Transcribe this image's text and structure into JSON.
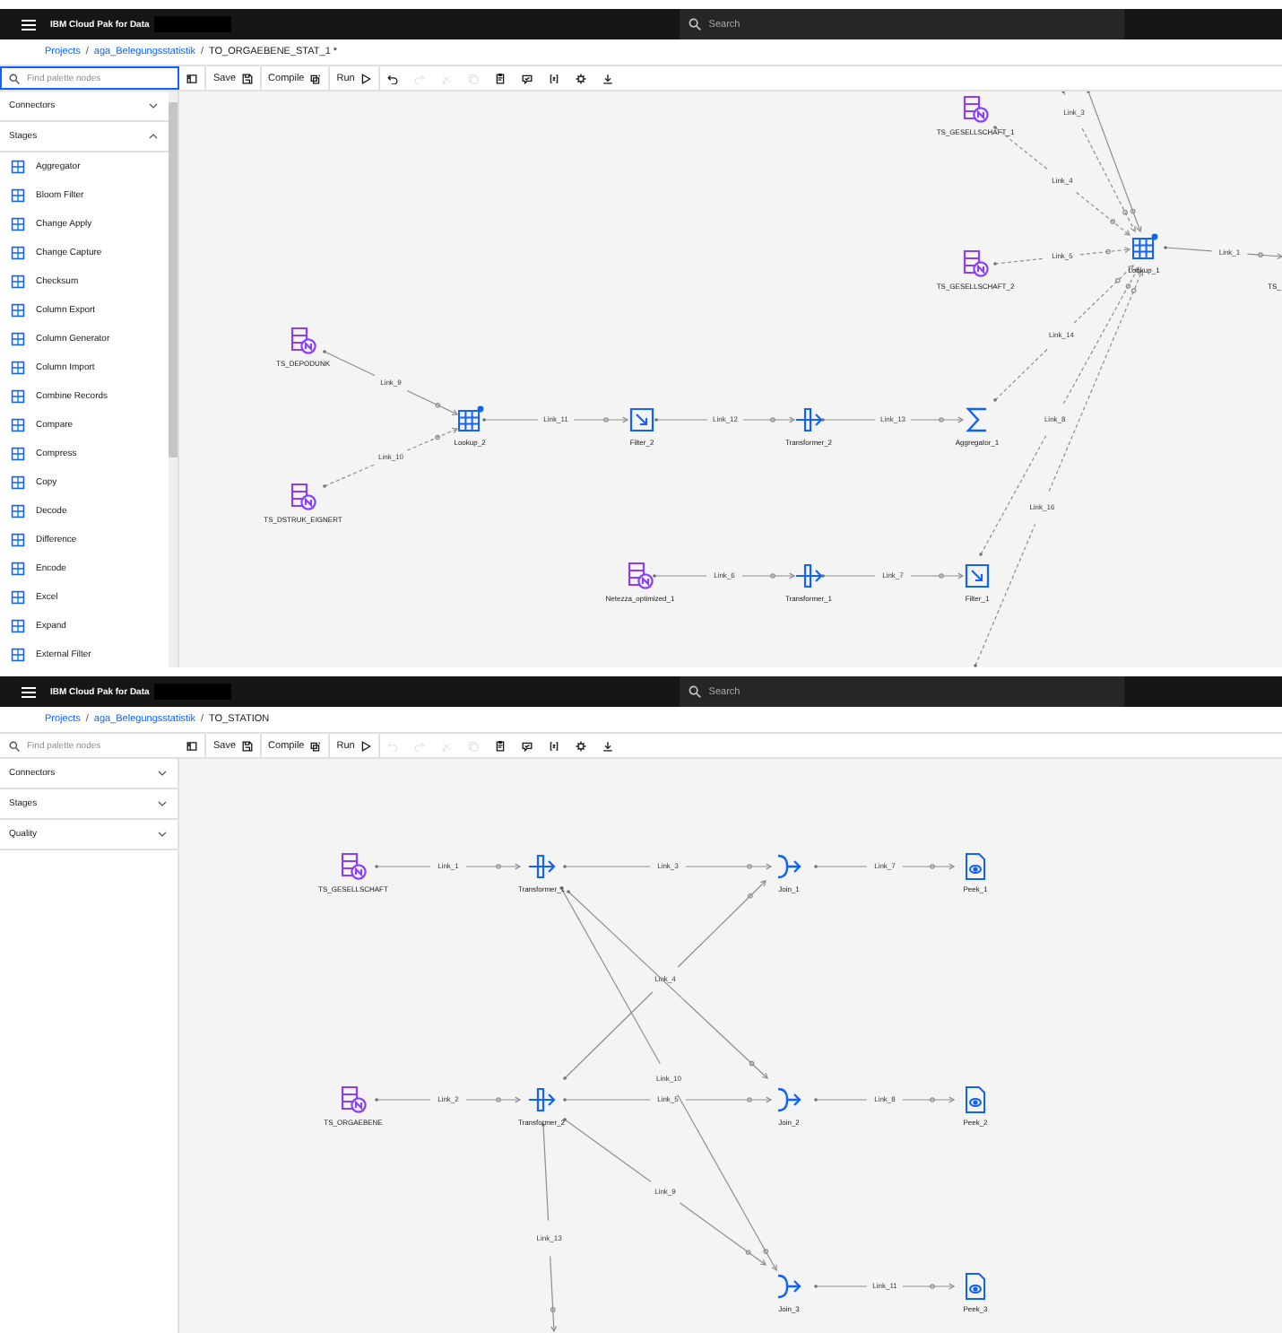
{
  "screens": [
    {
      "header": {
        "title": "IBM Cloud Pak for Data",
        "search": {
          "placeholder": "Search"
        }
      },
      "breadcrumb": [
        {
          "label": "Projects",
          "link": true,
          "separator": "/"
        },
        {
          "label": "aga_Belegungsstatistik",
          "link": true,
          "separator": "/"
        },
        {
          "label": "TO_ORGAEBENE_STAT_1 *",
          "link": false
        }
      ],
      "palette_search": {
        "placeholder": "Find palette nodes",
        "focused": true
      },
      "toolbar": [
        {
          "kind": "palette",
          "disabled": false
        },
        {
          "kind": "save",
          "label": "Save",
          "disabled": false
        },
        {
          "kind": "compile",
          "label": "Compile",
          "disabled": false
        },
        {
          "kind": "run",
          "label": "Run",
          "disabled": false
        },
        {
          "kind": "undo",
          "disabled": false
        },
        {
          "kind": "redo",
          "disabled": true
        },
        {
          "kind": "cut",
          "disabled": true
        },
        {
          "kind": "copy",
          "disabled": true
        },
        {
          "kind": "paste",
          "disabled": false
        },
        {
          "kind": "comment",
          "disabled": false
        },
        {
          "kind": "variables",
          "disabled": false
        },
        {
          "kind": "settings",
          "disabled": false
        },
        {
          "kind": "download",
          "disabled": false
        }
      ],
      "palette": [
        {
          "label": "Connectors",
          "expanded": false
        },
        {
          "label": "Stages",
          "expanded": true,
          "items": [
            "Aggregator",
            "Bloom Filter",
            "Change Apply",
            "Change Capture",
            "Checksum",
            "Column Export",
            "Column Generator",
            "Column Import",
            "Combine Records",
            "Compare",
            "Compress",
            "Copy",
            "Decode",
            "Difference",
            "Encode",
            "Excel",
            "Expand",
            "External Filter"
          ]
        }
      ],
      "canvas": {
        "nodes": [
          {
            "label": "TS_GESELLSCHAFT_1",
            "kind": "source"
          },
          {
            "label": "TS_GESELLSCHAFT_2",
            "kind": "source"
          },
          {
            "label": "Lookup_1",
            "kind": "lookup"
          },
          {
            "label": "TS_",
            "kind": "clipped"
          },
          {
            "label": "TS_DEPODUNK",
            "kind": "source"
          },
          {
            "label": "TS_DSTRUK_EIGNERT",
            "kind": "source"
          },
          {
            "label": "Lookup_2",
            "kind": "lookup"
          },
          {
            "label": "Filter_2",
            "kind": "filter"
          },
          {
            "label": "Transformer_2",
            "kind": "transformer"
          },
          {
            "label": "Aggregator_1",
            "kind": "aggregator"
          },
          {
            "label": "Netezza_optimized_1",
            "kind": "source"
          },
          {
            "label": "Transformer_1",
            "kind": "transformer"
          },
          {
            "label": "Filter_1",
            "kind": "filter"
          }
        ],
        "links": [
          {
            "label": "Link_3",
            "dashed": true
          },
          {
            "dashed": false
          },
          {
            "label": "Link_4",
            "dashed": true
          },
          {
            "label": "Link_5",
            "dashed": true
          },
          {
            "label": "Link_1",
            "dashed": false
          },
          {
            "label": "Link_14",
            "dashed": true
          },
          {
            "label": "Link_8",
            "dashed": true
          },
          {
            "label": "Link_16",
            "dashed": true
          },
          {
            "label": "Link_9",
            "dashed": false
          },
          {
            "label": "Link_10",
            "dashed": true
          },
          {
            "label": "Link_11",
            "dashed": false
          },
          {
            "label": "Link_12",
            "dashed": false
          },
          {
            "label": "Link_13",
            "dashed": false
          },
          {
            "label": "Link_6",
            "dashed": false
          },
          {
            "label": "Link_7",
            "dashed": false
          }
        ]
      }
    },
    {
      "header": {
        "title": "IBM Cloud Pak for Data",
        "search": {
          "placeholder": "Search"
        }
      },
      "breadcrumb": [
        {
          "label": "Projects",
          "link": true,
          "separator": "/"
        },
        {
          "label": "aga_Belegungsstatistik",
          "link": true,
          "separator": "/"
        },
        {
          "label": "TO_STATION",
          "link": false
        }
      ],
      "palette_search": {
        "placeholder": "Find palette nodes",
        "focused": false
      },
      "toolbar": [
        {
          "kind": "palette",
          "disabled": false
        },
        {
          "kind": "save",
          "label": "Save",
          "disabled": false
        },
        {
          "kind": "compile",
          "label": "Compile",
          "disabled": false
        },
        {
          "kind": "run",
          "label": "Run",
          "disabled": false
        },
        {
          "kind": "undo",
          "disabled": true
        },
        {
          "kind": "redo",
          "disabled": true
        },
        {
          "kind": "cut",
          "disabled": true
        },
        {
          "kind": "copy",
          "disabled": true
        },
        {
          "kind": "paste",
          "disabled": false
        },
        {
          "kind": "comment",
          "disabled": false
        },
        {
          "kind": "variables",
          "disabled": false
        },
        {
          "kind": "settings",
          "disabled": false
        },
        {
          "kind": "download",
          "disabled": false
        }
      ],
      "palette": [
        {
          "label": "Connectors",
          "expanded": false
        },
        {
          "label": "Stages",
          "expanded": false
        },
        {
          "label": "Quality",
          "expanded": false
        }
      ],
      "canvas": {
        "nodes": [
          {
            "label": "TS_GESELLSCHAFT",
            "kind": "source"
          },
          {
            "label": "Transformer_1",
            "kind": "transformer"
          },
          {
            "label": "Join_1",
            "kind": "join"
          },
          {
            "label": "Peek_1",
            "kind": "peek"
          },
          {
            "label": "TS_ORGAEBENE",
            "kind": "source"
          },
          {
            "label": "Transformer_2",
            "kind": "transformer"
          },
          {
            "label": "Join_2",
            "kind": "join"
          },
          {
            "label": "Peek_2",
            "kind": "peek"
          },
          {
            "label": "Join_3",
            "kind": "join"
          },
          {
            "label": "Peek_3",
            "kind": "peek"
          }
        ],
        "links": [
          {
            "label": "Link_1",
            "dashed": false
          },
          {
            "label": "Link_3",
            "dashed": false
          },
          {
            "label": "Link_7",
            "dashed": false
          },
          {
            "label": "Link_4",
            "dashed": false
          },
          {
            "dashed": false
          },
          {
            "label": "Link_10",
            "dashed": false
          },
          {
            "label": "Link_2",
            "dashed": false
          },
          {
            "label": "Link_5",
            "dashed": false
          },
          {
            "label": "Link_8",
            "dashed": false
          },
          {
            "label": "Link_9",
            "dashed": false
          },
          {
            "label": "Link_13",
            "dashed": false
          },
          {
            "label": "Link_11",
            "dashed": false
          }
        ]
      }
    }
  ]
}
